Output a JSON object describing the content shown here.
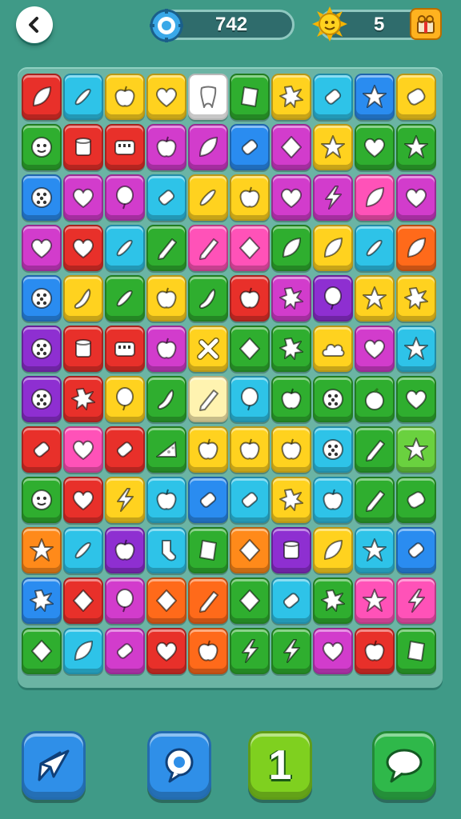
{
  "header": {
    "back_icon": "chevron-left-icon",
    "score": {
      "icon": "gear-badge-icon",
      "value": "742",
      "color": "#3aa8e8"
    },
    "coins": {
      "icon": "sun-coin-icon",
      "value": "5",
      "side_icon": "gift-icon"
    }
  },
  "board": {
    "rows": [
      [
        [
          "#e8302a",
          "leaf"
        ],
        [
          "#2ec3e8",
          "pickle"
        ],
        [
          "#ffd21f",
          "apple"
        ],
        [
          "#ffd21f",
          "heart"
        ],
        [
          "#ffffff",
          "tooth"
        ],
        [
          "#2fae2f",
          "gem"
        ],
        [
          "#ffd21f",
          "splat"
        ],
        [
          "#2ec3e8",
          "candy"
        ],
        [
          "#2a8cf0",
          "star"
        ],
        [
          "#ffd21f",
          "barrel"
        ]
      ],
      [
        [
          "#2fae2f",
          "face"
        ],
        [
          "#e8302a",
          "cup"
        ],
        [
          "#e8302a",
          "radio"
        ],
        [
          "#d23ccc",
          "apple"
        ],
        [
          "#d23ccc",
          "leaf"
        ],
        [
          "#2a8cf0",
          "candy"
        ],
        [
          "#d23ccc",
          "diamond"
        ],
        [
          "#ffd21f",
          "star"
        ],
        [
          "#2fae2f",
          "heart"
        ],
        [
          "#2fae2f",
          "star"
        ]
      ],
      [
        [
          "#2a8cf0",
          "dots"
        ],
        [
          "#d23ccc",
          "heart"
        ],
        [
          "#d23ccc",
          "balloon"
        ],
        [
          "#2ec3e8",
          "candy"
        ],
        [
          "#ffd21f",
          "pickle"
        ],
        [
          "#ffd21f",
          "apple"
        ],
        [
          "#d23ccc",
          "heart"
        ],
        [
          "#d23ccc",
          "bolt"
        ],
        [
          "#ff52b8",
          "leaf"
        ],
        [
          "#d23ccc",
          "heart"
        ]
      ],
      [
        [
          "#d23ccc",
          "heart"
        ],
        [
          "#e8302a",
          "heart"
        ],
        [
          "#2ec3e8",
          "pickle"
        ],
        [
          "#2fae2f",
          "pencil"
        ],
        [
          "#ff52b8",
          "pencil"
        ],
        [
          "#ff52b8",
          "diamond"
        ],
        [
          "#2fae2f",
          "leaf"
        ],
        [
          "#ffd21f",
          "leaf"
        ],
        [
          "#2ec3e8",
          "pickle"
        ],
        [
          "#ff6a1a",
          "leaf"
        ]
      ],
      [
        [
          "#2a8cf0",
          "dots"
        ],
        [
          "#ffd21f",
          "pepper"
        ],
        [
          "#2fae2f",
          "pickle"
        ],
        [
          "#ffd21f",
          "apple"
        ],
        [
          "#2fae2f",
          "pepper"
        ],
        [
          "#e8302a",
          "apple"
        ],
        [
          "#d23ccc",
          "splat"
        ],
        [
          "#8e2fd1",
          "balloon"
        ],
        [
          "#ffd21f",
          "star"
        ],
        [
          "#ffd21f",
          "splat"
        ]
      ],
      [
        [
          "#8e2fd1",
          "dots"
        ],
        [
          "#e8302a",
          "cup"
        ],
        [
          "#e8302a",
          "radio"
        ],
        [
          "#d23ccc",
          "apple"
        ],
        [
          "#ffd21f",
          "cross"
        ],
        [
          "#2fae2f",
          "diamond"
        ],
        [
          "#2fae2f",
          "splat"
        ],
        [
          "#ffd21f",
          "cloud"
        ],
        [
          "#d23ccc",
          "heart"
        ],
        [
          "#2ec3e8",
          "star"
        ]
      ],
      [
        [
          "#8e2fd1",
          "dots"
        ],
        [
          "#e8302a",
          "splat"
        ],
        [
          "#ffd21f",
          "balloon"
        ],
        [
          "#2fae2f",
          "pepper"
        ],
        [
          "#fff3b0",
          "pencil"
        ],
        [
          "#2ec3e8",
          "balloon"
        ],
        [
          "#2fae2f",
          "apple"
        ],
        [
          "#2fae2f",
          "dots"
        ],
        [
          "#2fae2f",
          "orange"
        ],
        [
          "#2fae2f",
          "heart"
        ]
      ],
      [
        [
          "#e8302a",
          "candy"
        ],
        [
          "#ff52b8",
          "heart"
        ],
        [
          "#e8302a",
          "candy"
        ],
        [
          "#2fae2f",
          "cheese"
        ],
        [
          "#ffd21f",
          "apple"
        ],
        [
          "#ffd21f",
          "apple"
        ],
        [
          "#ffd21f",
          "apple"
        ],
        [
          "#2ec3e8",
          "dots"
        ],
        [
          "#2fae2f",
          "pencil"
        ],
        [
          "#6ad13f",
          "star"
        ]
      ],
      [
        [
          "#2fae2f",
          "face"
        ],
        [
          "#e8302a",
          "heart"
        ],
        [
          "#ffd21f",
          "bolt"
        ],
        [
          "#2ec3e8",
          "apple"
        ],
        [
          "#2a8cf0",
          "candy"
        ],
        [
          "#2ec3e8",
          "candy"
        ],
        [
          "#ffd21f",
          "splat"
        ],
        [
          "#2ec3e8",
          "apple"
        ],
        [
          "#2fae2f",
          "pencil"
        ],
        [
          "#2fae2f",
          "barrel"
        ]
      ],
      [
        [
          "#ff8a1a",
          "star"
        ],
        [
          "#2ec3e8",
          "pickle"
        ],
        [
          "#8e2fd1",
          "apple"
        ],
        [
          "#2ec3e8",
          "sock"
        ],
        [
          "#2fae2f",
          "gem"
        ],
        [
          "#ff8a1a",
          "diamond"
        ],
        [
          "#8e2fd1",
          "cup"
        ],
        [
          "#ffd21f",
          "leaf"
        ],
        [
          "#2ec3e8",
          "star"
        ],
        [
          "#2a8cf0",
          "candy"
        ]
      ],
      [
        [
          "#2a8cf0",
          "splat"
        ],
        [
          "#e8302a",
          "diamond"
        ],
        [
          "#d23ccc",
          "balloon"
        ],
        [
          "#ff6a1a",
          "diamond"
        ],
        [
          "#ff6a1a",
          "pencil"
        ],
        [
          "#2fae2f",
          "diamond"
        ],
        [
          "#2ec3e8",
          "candy"
        ],
        [
          "#2fae2f",
          "splat"
        ],
        [
          "#ff52b8",
          "star"
        ],
        [
          "#ff52b8",
          "bolt"
        ]
      ],
      [
        [
          "#2fae2f",
          "diamond"
        ],
        [
          "#2ec3e8",
          "leaf"
        ],
        [
          "#d23ccc",
          "candy"
        ],
        [
          "#e8302a",
          "heart"
        ],
        [
          "#ff6a1a",
          "apple"
        ],
        [
          "#2fae2f",
          "bolt"
        ],
        [
          "#2fae2f",
          "bolt"
        ],
        [
          "#d23ccc",
          "heart"
        ],
        [
          "#e8302a",
          "apple"
        ],
        [
          "#2fae2f",
          "gem"
        ]
      ]
    ]
  },
  "actions": [
    {
      "name": "share-button",
      "icon": "send-arrow-icon",
      "color": "#2f8fe8"
    },
    {
      "name": "search-button",
      "icon": "magnifier-bubble-icon",
      "color": "#2f8fe8"
    },
    {
      "name": "hint-button",
      "icon": "number-badge",
      "label": "1",
      "color": "#7fd01f"
    },
    {
      "name": "chat-button",
      "icon": "speech-bubble-icon",
      "color": "#2fb84a"
    }
  ]
}
